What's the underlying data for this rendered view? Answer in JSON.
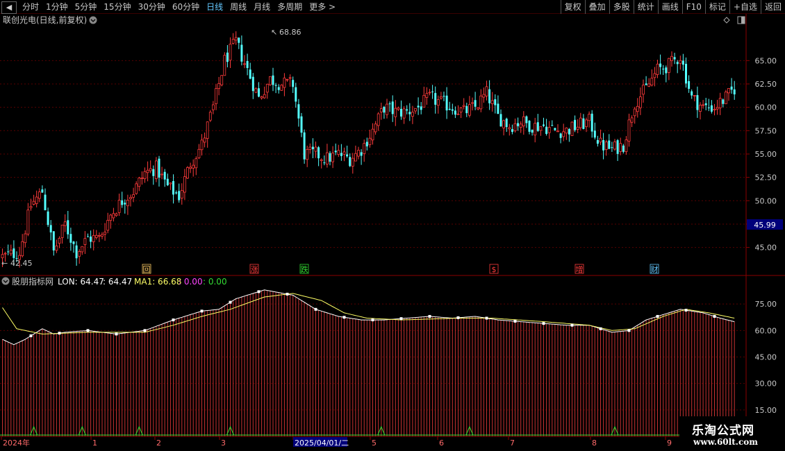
{
  "toolbar": {
    "nav_back": "◀",
    "period_tabs": [
      {
        "label": "分时",
        "active": false
      },
      {
        "label": "1分钟",
        "active": false
      },
      {
        "label": "5分钟",
        "active": false
      },
      {
        "label": "15分钟",
        "active": false
      },
      {
        "label": "30分钟",
        "active": false
      },
      {
        "label": "60分钟",
        "active": false
      },
      {
        "label": "日线",
        "active": true
      },
      {
        "label": "周线",
        "active": false
      },
      {
        "label": "月线",
        "active": false
      },
      {
        "label": "多周期",
        "active": false
      },
      {
        "label": "更多 >",
        "active": false
      }
    ],
    "buttons": [
      "复权",
      "叠加",
      "多股",
      "统计",
      "画线",
      "F10",
      "标记",
      "+自选",
      "返回"
    ]
  },
  "main_pane": {
    "title": "联创光电(日线,前复权)",
    "high_label": "68.86",
    "low_label": "42.45",
    "current_price": "45.99",
    "events": [
      {
        "label": "回",
        "color": "#ffcc66"
      },
      {
        "label": "涨",
        "color": "#ff3b3b"
      },
      {
        "label": "跌",
        "color": "#33dd33"
      },
      {
        "label": "$",
        "color": "#ff3b3b"
      },
      {
        "label": "增",
        "color": "#ff3b3b"
      },
      {
        "label": "财",
        "color": "#64c8ff"
      }
    ]
  },
  "indicator_pane": {
    "name": "股朋指标网",
    "lon_label": "LON: 64.47",
    "lon_value2": ": 64.47",
    "ma1_label": "MA1: 66.68",
    "v3": ": 0.00",
    "v4": ": 0.00",
    "colors": {
      "lon": "#ffffff",
      "ma1": "#ffff66",
      "v3": "#ff44ff",
      "v4": "#33dd33"
    }
  },
  "time_axis": {
    "labels": [
      "2024年",
      "1",
      "2",
      "3",
      "2025/04/01/二",
      "5",
      "6",
      "7",
      "8",
      "9"
    ]
  },
  "watermark": {
    "name": "乐淘公式网",
    "url": "www.60lt.com"
  },
  "chart_data": {
    "type": "candlestick",
    "price_axis": {
      "ticks": [
        45.0,
        47.5,
        50.0,
        52.5,
        55.0,
        57.5,
        60.0,
        62.5,
        65.0
      ],
      "range": [
        42.0,
        70.0
      ]
    },
    "indicator_axis": {
      "ticks": [
        15.0,
        30.0,
        45.0,
        60.0,
        75.0
      ],
      "range": [
        0,
        90
      ]
    },
    "price_anchors": [
      [
        0,
        44.0
      ],
      [
        6,
        44.5
      ],
      [
        10,
        49.5
      ],
      [
        14,
        51.0
      ],
      [
        18,
        44.5
      ],
      [
        22,
        47.5
      ],
      [
        26,
        44.5
      ],
      [
        30,
        46.0
      ],
      [
        34,
        46.0
      ],
      [
        38,
        48.5
      ],
      [
        42,
        50.0
      ],
      [
        46,
        51.0
      ],
      [
        50,
        53.0
      ],
      [
        54,
        53.5
      ],
      [
        58,
        51.5
      ],
      [
        62,
        50.5
      ],
      [
        66,
        54.0
      ],
      [
        70,
        56.0
      ],
      [
        74,
        60.0
      ],
      [
        78,
        65.0
      ],
      [
        82,
        67.0
      ],
      [
        86,
        64.0
      ],
      [
        90,
        61.0
      ],
      [
        94,
        63.0
      ],
      [
        98,
        62.5
      ],
      [
        102,
        62.5
      ],
      [
        106,
        55.0
      ],
      [
        110,
        55.0
      ],
      [
        114,
        54.5
      ],
      [
        118,
        55.0
      ],
      [
        122,
        54.5
      ],
      [
        126,
        55.5
      ],
      [
        130,
        57.5
      ],
      [
        134,
        60.0
      ],
      [
        138,
        59.5
      ],
      [
        142,
        59.5
      ],
      [
        146,
        60.0
      ],
      [
        150,
        61.0
      ],
      [
        154,
        60.5
      ],
      [
        158,
        60.0
      ],
      [
        162,
        59.5
      ],
      [
        166,
        60.0
      ],
      [
        170,
        61.5
      ],
      [
        174,
        59.0
      ],
      [
        178,
        58.0
      ],
      [
        182,
        58.5
      ],
      [
        186,
        58.0
      ],
      [
        190,
        58.0
      ],
      [
        194,
        57.5
      ],
      [
        198,
        57.5
      ],
      [
        202,
        58.0
      ],
      [
        206,
        58.5
      ],
      [
        210,
        56.0
      ],
      [
        214,
        55.5
      ],
      [
        218,
        56.0
      ],
      [
        222,
        60.5
      ],
      [
        226,
        62.0
      ],
      [
        230,
        64.0
      ],
      [
        234,
        64.5
      ],
      [
        238,
        65.5
      ],
      [
        242,
        61.0
      ],
      [
        246,
        60.0
      ],
      [
        250,
        60.0
      ],
      [
        254,
        61.0
      ],
      [
        257,
        62.0
      ]
    ],
    "lon_anchors": [
      [
        0,
        55
      ],
      [
        4,
        52
      ],
      [
        8,
        55
      ],
      [
        14,
        61
      ],
      [
        18,
        58
      ],
      [
        22,
        59
      ],
      [
        30,
        60
      ],
      [
        40,
        58
      ],
      [
        50,
        60
      ],
      [
        60,
        66
      ],
      [
        70,
        71
      ],
      [
        76,
        72
      ],
      [
        82,
        78
      ],
      [
        92,
        83
      ],
      [
        102,
        80
      ],
      [
        110,
        72
      ],
      [
        118,
        68
      ],
      [
        126,
        66
      ],
      [
        134,
        66
      ],
      [
        142,
        67
      ],
      [
        150,
        68
      ],
      [
        158,
        67
      ],
      [
        166,
        68
      ],
      [
        174,
        66
      ],
      [
        182,
        65
      ],
      [
        190,
        64
      ],
      [
        198,
        63
      ],
      [
        206,
        63
      ],
      [
        214,
        59
      ],
      [
        220,
        60
      ],
      [
        226,
        66
      ],
      [
        232,
        69
      ],
      [
        238,
        72
      ],
      [
        246,
        70
      ],
      [
        252,
        67
      ],
      [
        257,
        65
      ]
    ],
    "ma1_anchors": [
      [
        0,
        73
      ],
      [
        5,
        61
      ],
      [
        14,
        58
      ],
      [
        30,
        59
      ],
      [
        50,
        59
      ],
      [
        60,
        63
      ],
      [
        70,
        68
      ],
      [
        80,
        72
      ],
      [
        92,
        79
      ],
      [
        102,
        81
      ],
      [
        112,
        77
      ],
      [
        120,
        70
      ],
      [
        128,
        67
      ],
      [
        140,
        66
      ],
      [
        160,
        67
      ],
      [
        172,
        67
      ],
      [
        190,
        65
      ],
      [
        206,
        63
      ],
      [
        214,
        60
      ],
      [
        222,
        61
      ],
      [
        232,
        68
      ],
      [
        240,
        72
      ],
      [
        248,
        70
      ],
      [
        257,
        67
      ]
    ],
    "n_bars": 258,
    "rise_markers": [
      11,
      28,
      48,
      80,
      133,
      164,
      215
    ]
  }
}
